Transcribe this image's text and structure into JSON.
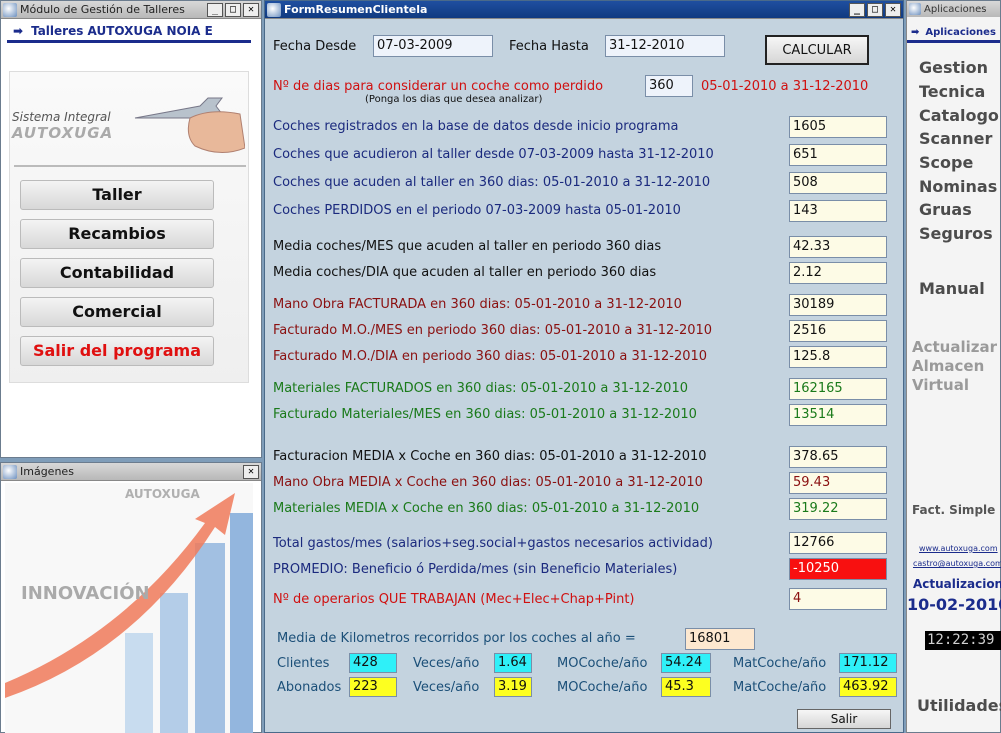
{
  "left_window": {
    "title": "Módulo de Gestión de Talleres",
    "header": "Talleres AUTOXUGA NOIA E",
    "logo_line1": "Sistema Integral",
    "logo_line2": "AUTOXUGA",
    "buttons": [
      "Taller",
      "Recambios",
      "Contabilidad",
      "Comercial",
      "Salir del programa"
    ]
  },
  "images_window": {
    "title": "Imágenes",
    "brand": "AUTOXUGA",
    "tagline": "INNOVACIÓN"
  },
  "main": {
    "title": "FormResumenClientela",
    "fecha_desde_label": "Fecha Desde",
    "fecha_desde": "07-03-2009",
    "fecha_hasta_label": "Fecha Hasta",
    "fecha_hasta": "31-12-2010",
    "calc_label": "CALCULAR",
    "dias_label": "Nº de dias para considerar un coche como perdido",
    "dias": "360",
    "dias_range": "05-01-2010 a 31-12-2010",
    "dias_hint": "(Ponga los dias que desea analizar)",
    "rows": [
      {
        "label": "Coches registrados en la base de datos desde inicio programa",
        "value": "1605"
      },
      {
        "label": "Coches que acudieron al taller desde 07-03-2009 hasta 31-12-2010",
        "value": "651"
      },
      {
        "label": "Coches que acuden al taller en 360 dias: 05-01-2010 a 31-12-2010",
        "value": "508"
      },
      {
        "label": "Coches PERDIDOS en el periodo 07-03-2009 hasta 05-01-2010",
        "value": "143"
      },
      {
        "label": "Media coches/MES que acuden al taller en periodo 360 dias",
        "value": "42.33"
      },
      {
        "label": "Media coches/DIA que acuden al taller en periodo 360 dias",
        "value": "2.12"
      },
      {
        "label": "Mano Obra FACTURADA en 360 dias: 05-01-2010 a 31-12-2010",
        "value": "30189"
      },
      {
        "label": "Facturado M.O./MES en periodo 360 dias: 05-01-2010 a 31-12-2010",
        "value": "2516"
      },
      {
        "label": "Facturado M.O./DIA en periodo 360 dias: 05-01-2010 a 31-12-2010",
        "value": "125.8"
      },
      {
        "label": "Materiales FACTURADOS en 360 dias: 05-01-2010 a 31-12-2010",
        "value": "162165"
      },
      {
        "label": "Facturado Materiales/MES en 360 dias: 05-01-2010 a 31-12-2010",
        "value": "13514"
      },
      {
        "label": "Facturacion MEDIA x Coche en 360 dias: 05-01-2010 a 31-12-2010",
        "value": "378.65"
      },
      {
        "label": "Mano Obra MEDIA x Coche en 360 dias: 05-01-2010 a 31-12-2010",
        "value": "59.43"
      },
      {
        "label": "Materiales MEDIA x Coche en 360 dias: 05-01-2010 a 31-12-2010",
        "value": "319.22"
      },
      {
        "label": "Total gastos/mes (salarios+seg.social+gastos necesarios actividad)",
        "value": "12766"
      },
      {
        "label": "PROMEDIO: Beneficio ó Perdida/mes (sin Beneficio Materiales)",
        "value": "-10250"
      },
      {
        "label": "Nº de operarios QUE TRABAJAN (Mec+Elec+Chap+Pint)",
        "value": "4"
      }
    ],
    "km_label": "Media de Kilometros recorridos por los coches al año =",
    "km_value": "16801",
    "clientes_label": "Clientes",
    "clientes": "428",
    "abonados_label": "Abonados",
    "abonados": "223",
    "veces_label": "Veces/año",
    "veces1": "1.64",
    "veces2": "3.19",
    "mocoche_label": "MOCoche/año",
    "mocoche1": "54.24",
    "mocoche2": "45.3",
    "matcoche_label": "MatCoche/año",
    "matcoche1": "171.12",
    "matcoche2": "463.92",
    "salir_label": "Salir"
  },
  "right_window": {
    "title": "Aplicaciones",
    "header": "Aplicaciones",
    "items": [
      "Gestion",
      "Tecnica",
      "Catalogo",
      "Scanner",
      "Scope",
      "Nominas",
      "Gruas",
      "Seguros"
    ],
    "manual": "Manual",
    "grey1": "Actualizar",
    "grey2": "Almacen",
    "grey3": "Virtual",
    "fact": "Fact. Simple",
    "link1": "www.autoxuga.com",
    "link2": "castro@autoxuga.com",
    "act_label": "Actualizacione",
    "act_date": "10-02-2010",
    "clock": "12:22:39",
    "util": "Utilidades"
  }
}
